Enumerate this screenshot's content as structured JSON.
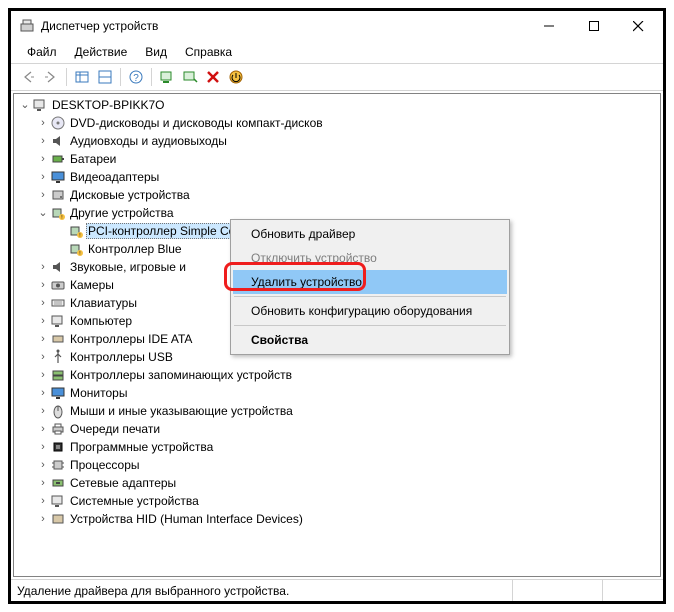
{
  "window": {
    "title": "Диспетчер устройств"
  },
  "menubar": {
    "file": "Файл",
    "action": "Действие",
    "view": "Вид",
    "help": "Справка"
  },
  "tree": {
    "root": "DESKTOP-BPIKK7O",
    "dvd": "DVD-дисководы и дисководы компакт-дисков",
    "audio": "Аудиовходы и аудиовыходы",
    "battery": "Батареи",
    "video": "Видеоадаптеры",
    "disk": "Дисковые устройства",
    "other": "Другие устройства",
    "other_pci": "PCI-контроллер Simple Communications",
    "other_bt": "Контроллер Blue",
    "sound": "Звуковые, игровые и",
    "camera": "Камеры",
    "keyboard": "Клавиатуры",
    "computer": "Компьютер",
    "ide": "Контроллеры IDE ATA",
    "usb": "Контроллеры USB",
    "storage": "Контроллеры запоминающих устройств",
    "monitor": "Мониторы",
    "mouse": "Мыши и иные указывающие устройства",
    "print": "Очереди печати",
    "firmware": "Программные устройства",
    "cpu": "Процессоры",
    "network": "Сетевые адаптеры",
    "system": "Системные устройства",
    "hid": "Устройства HID (Human Interface Devices)"
  },
  "context_menu": {
    "update": "Обновить драйвер",
    "disable": "Отключить устройство",
    "uninstall": "Удалить устройство",
    "scan": "Обновить конфигурацию оборудования",
    "properties": "Свойства"
  },
  "statusbar": {
    "text": "Удаление драйвера для выбранного устройства."
  }
}
